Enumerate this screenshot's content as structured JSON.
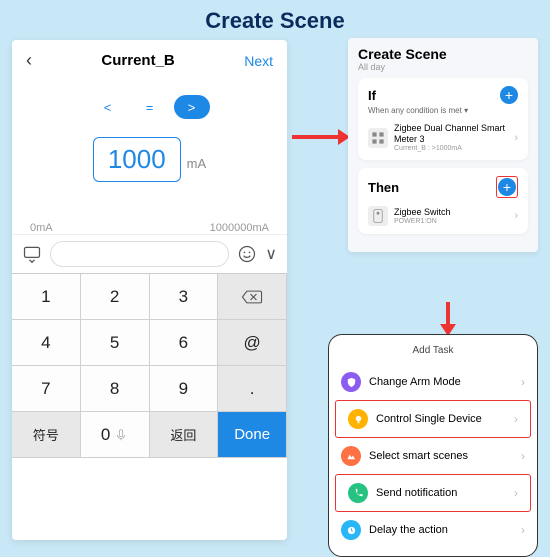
{
  "page_title": "Create Scene",
  "left_panel": {
    "title": "Current_B",
    "next": "Next",
    "comparators": {
      "lt": "<",
      "eq": "=",
      "gt": ">"
    },
    "value": "1000",
    "unit": "mA",
    "range_min": "0mA",
    "range_max": "1000000mA",
    "keys": {
      "k1": "1",
      "k2": "2",
      "k3": "3",
      "k4": "4",
      "k5": "5",
      "k6": "6",
      "k7": "7",
      "k8": "8",
      "k9": "9",
      "k0": "0",
      "at": "@",
      "dot": ".",
      "sym": "符号",
      "ret": "返回",
      "done": "Done"
    }
  },
  "scene": {
    "title": "Create Scene",
    "sub": "All day",
    "if_label": "If",
    "if_cond": "When any condition is met",
    "device1_name": "Zigbee Dual Channel Smart Meter 3",
    "device1_sub": "Current_B : >1000mA",
    "then_label": "Then",
    "device2_name": "Zigbee Switch",
    "device2_sub": "POWER1:ON"
  },
  "add_task": {
    "title": "Add Task",
    "t1": "Change Arm Mode",
    "t2": "Control Single Device",
    "t3": "Select smart scenes",
    "t4": "Send notification",
    "t5": "Delay the action"
  }
}
